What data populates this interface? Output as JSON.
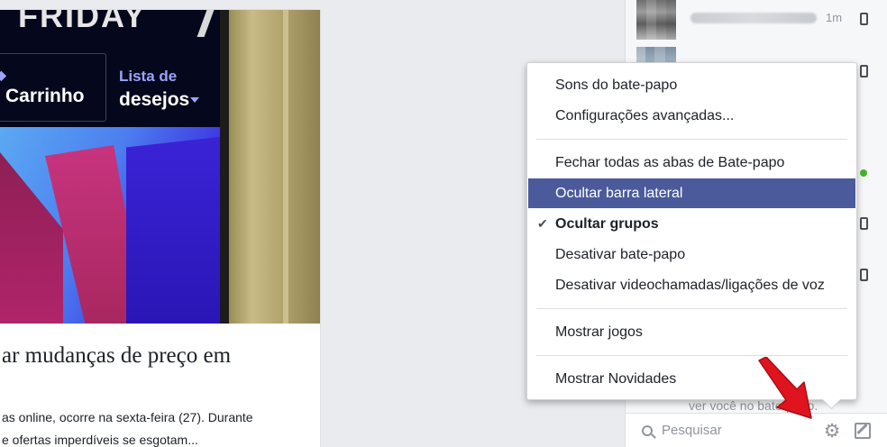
{
  "post": {
    "image": {
      "top_word": "FRIDAY",
      "nav_left_small": "◆",
      "nav_left_big": "Carrinho",
      "nav_right_small": "Lista de",
      "nav_right_big": "desejos"
    },
    "headline": "ar mudanças de preço em",
    "body_lines": [
      "as online, ocorre na sexta-feira (27). Durante",
      "e ofertas imperdíveis se esgotam..."
    ]
  },
  "chat": {
    "contacts": [
      {
        "time": "1m",
        "device": "mobile"
      },
      {
        "device": "mobile"
      }
    ],
    "behind_text": "ver você no bate-papo.",
    "search": {
      "placeholder": "Pesquisar"
    }
  },
  "menu": {
    "items": [
      {
        "label": "Sons do bate-papo"
      },
      {
        "label": "Configurações avançadas..."
      },
      {
        "label": "Fechar todas as abas de Bate-papo"
      },
      {
        "label": "Ocultar barra lateral",
        "state": "highlighted"
      },
      {
        "label": "Ocultar grupos",
        "state": "checked"
      },
      {
        "label": "Desativar bate-papo"
      },
      {
        "label": "Desativar videochamadas/ligações de voz"
      },
      {
        "label": "Mostrar jogos"
      },
      {
        "label": "Mostrar Novidades"
      }
    ],
    "check_glyph": "✔"
  },
  "colors": {
    "highlight": "#4b5a9a",
    "online": "#42b72a",
    "annotation_arrow": "#e0141e"
  }
}
